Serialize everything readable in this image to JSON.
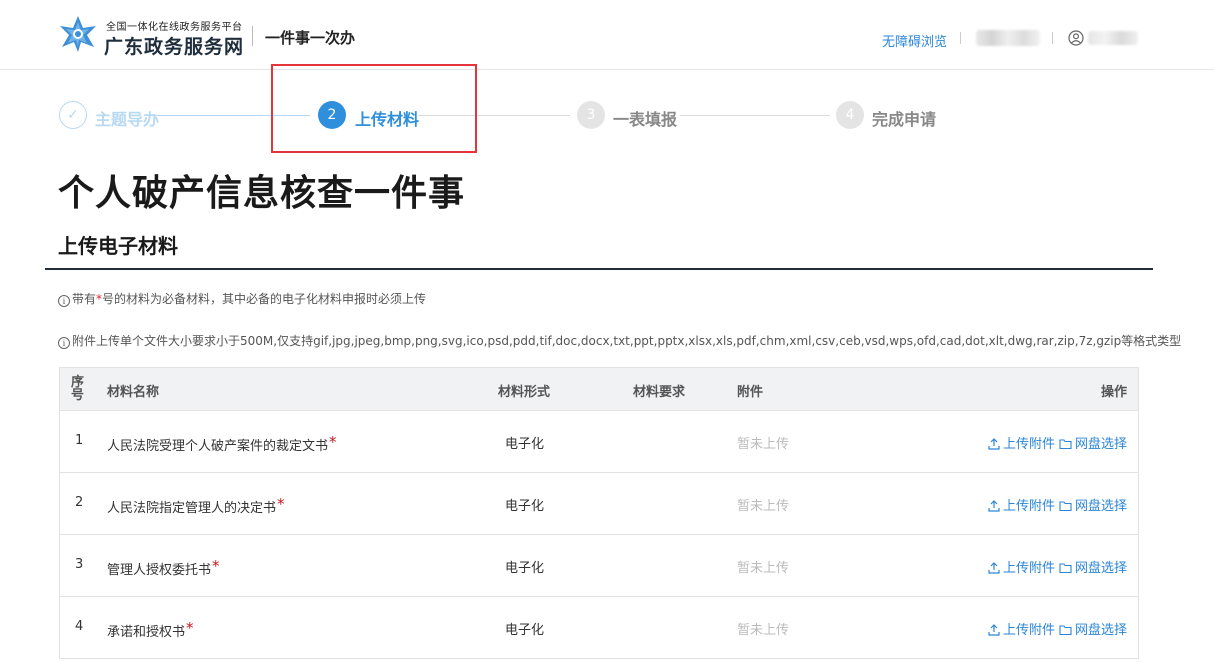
{
  "header": {
    "brand_small": "全国一体化在线政务服务平台",
    "brand_big": "广东政务服务网",
    "brand_sub": "一件事一次办",
    "accessibility_link": "无障碍浏览"
  },
  "steps": [
    {
      "number": "✓",
      "label": "主题导办",
      "state": "done"
    },
    {
      "number": "2",
      "label": "上传材料",
      "state": "active"
    },
    {
      "number": "3",
      "label": "一表填报",
      "state": "pending"
    },
    {
      "number": "4",
      "label": "完成申请",
      "state": "pending"
    }
  ],
  "page_title": "个人破产信息核查一件事",
  "section_title": "上传电子材料",
  "notes": {
    "note1_pre": "带有",
    "note1_star": "*",
    "note1_post": "号的材料为必备材料，其中必备的电子化材料申报时必须上传",
    "note2": "附件上传单个文件大小要求小于500M,仅支持gif,jpg,jpeg,bmp,png,svg,ico,psd,pdd,tif,doc,docx,txt,ppt,pptx,xlsx,xls,pdf,chm,xml,csv,ceb,vsd,wps,ofd,cad,dot,xlt,dwg,rar,zip,7z,gzip等格式类型"
  },
  "table": {
    "headers": {
      "index": "序号",
      "name": "材料名称",
      "form": "材料形式",
      "requirement": "材料要求",
      "attachment": "附件",
      "operation": "操作"
    },
    "rows": [
      {
        "index": "1",
        "name": "人民法院受理个人破产案件的裁定文书",
        "required": "*",
        "form": "电子化",
        "attachment": "暂未上传",
        "upload": "上传附件",
        "cloud": "网盘选择"
      },
      {
        "index": "2",
        "name": "人民法院指定管理人的决定书",
        "required": "*",
        "form": "电子化",
        "attachment": "暂未上传",
        "upload": "上传附件",
        "cloud": "网盘选择"
      },
      {
        "index": "3",
        "name": "管理人授权委托书",
        "required": "*",
        "form": "电子化",
        "attachment": "暂未上传",
        "upload": "上传附件",
        "cloud": "网盘选择"
      },
      {
        "index": "4",
        "name": "承诺和授权书",
        "required": "*",
        "form": "电子化",
        "attachment": "暂未上传",
        "upload": "上传附件",
        "cloud": "网盘选择"
      }
    ]
  },
  "colors": {
    "accent": "#2f8fdc",
    "link": "#2b86d6",
    "highlight": "#e5353a",
    "required": "#c8161d"
  }
}
